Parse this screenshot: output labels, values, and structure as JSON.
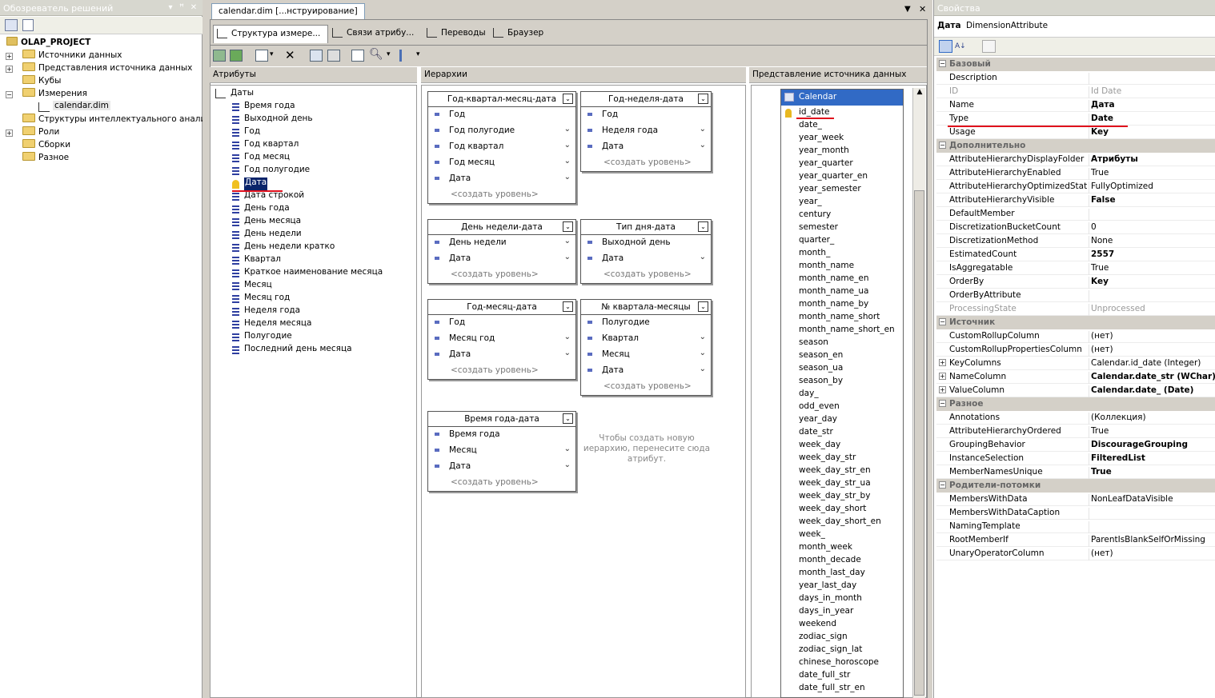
{
  "solution_explorer": {
    "title": "Обозреватель решений",
    "project": "OLAP_PROJECT",
    "items": [
      {
        "label": "Источники данных"
      },
      {
        "label": "Представления источника данных"
      },
      {
        "label": "Кубы"
      },
      {
        "label": "Измерения"
      },
      {
        "label": "calendar.dim"
      },
      {
        "label": "Структуры интеллектуального анализа"
      },
      {
        "label": "Роли"
      },
      {
        "label": "Сборки"
      },
      {
        "label": "Разное"
      }
    ]
  },
  "document": {
    "tab": "calendar.dim [...нструирование]",
    "subtabs": [
      "Структура измере...",
      "Связи атрибу...",
      "Переводы",
      "Браузер"
    ]
  },
  "attributes": {
    "header": "Атрибуты",
    "root": "Даты",
    "items": [
      "Время года",
      "Выходной день",
      "Год",
      "Год квартал",
      "Год месяц",
      "Год полугодие",
      "Дата",
      "Дата строкой",
      "День года",
      "День месяца",
      "День недели",
      "День недели кратко",
      "Квартал",
      "Краткое наименование месяца",
      "Месяц",
      "Месяц год",
      "Неделя года",
      "Неделя месяца",
      "Полугодие",
      "Последний день месяца"
    ]
  },
  "hierarchies": {
    "header": "Иерархии",
    "new_level": "<создать уровень>",
    "hint": "Чтобы создать новую иерархию, перенесите сюда атрибут.",
    "boxes": [
      {
        "title": "Год-квартал-месяц-дата",
        "levels": [
          "Год",
          "Год полугодие",
          "Год квартал",
          "Год месяц",
          "Дата"
        ]
      },
      {
        "title": "Год-неделя-дата",
        "levels": [
          "Год",
          "Неделя года",
          "Дата"
        ]
      },
      {
        "title": "День недели-дата",
        "levels": [
          "День недели",
          "Дата"
        ]
      },
      {
        "title": "Тип дня-дата",
        "levels": [
          "Выходной день",
          "Дата"
        ]
      },
      {
        "title": "Год-месяц-дата",
        "levels": [
          "Год",
          "Месяц год",
          "Дата"
        ]
      },
      {
        "title": "№ квартала-месяцы",
        "levels": [
          "Полугодие",
          "Квартал",
          "Месяц",
          "Дата"
        ]
      },
      {
        "title": "Время года-дата",
        "levels": [
          "Время года",
          "Месяц",
          "Дата"
        ]
      }
    ]
  },
  "dsv": {
    "header": "Представление источника данных",
    "table": "Calendar",
    "columns": [
      "id_date",
      "date_",
      "year_week",
      "year_month",
      "year_quarter",
      "year_quarter_en",
      "year_semester",
      "year_",
      "century",
      "semester",
      "quarter_",
      "month_",
      "month_name",
      "month_name_en",
      "month_name_ua",
      "month_name_by",
      "month_name_short",
      "month_name_short_en",
      "season",
      "season_en",
      "season_ua",
      "season_by",
      "day_",
      "odd_even",
      "year_day",
      "date_str",
      "week_day",
      "week_day_str",
      "week_day_str_en",
      "week_day_str_ua",
      "week_day_str_by",
      "week_day_short",
      "week_day_short_en",
      "week_",
      "month_week",
      "month_decade",
      "month_last_day",
      "year_last_day",
      "days_in_month",
      "days_in_year",
      "weekend",
      "zodiac_sign",
      "zodiac_sign_lat",
      "chinese_horoscope",
      "date_full_str",
      "date_full_str_en"
    ]
  },
  "properties": {
    "title": "Свойства",
    "object_name": "Дата",
    "object_type": "DimensionAttribute",
    "categories": [
      {
        "name": "Базовый",
        "rows": [
          {
            "n": "Description",
            "v": ""
          },
          {
            "n": "ID",
            "v": "Id Date"
          },
          {
            "n": "Name",
            "v": "Дата"
          },
          {
            "n": "Type",
            "v": "Date"
          },
          {
            "n": "Usage",
            "v": "Key"
          }
        ]
      },
      {
        "name": "Дополнительно",
        "rows": [
          {
            "n": "AttributeHierarchyDisplayFolder",
            "v": "Атрибуты"
          },
          {
            "n": "AttributeHierarchyEnabled",
            "v": "True"
          },
          {
            "n": "AttributeHierarchyOptimizedState",
            "v": "FullyOptimized"
          },
          {
            "n": "AttributeHierarchyVisible",
            "v": "False"
          },
          {
            "n": "DefaultMember",
            "v": ""
          },
          {
            "n": "DiscretizationBucketCount",
            "v": "0"
          },
          {
            "n": "DiscretizationMethod",
            "v": "None"
          },
          {
            "n": "EstimatedCount",
            "v": "2557"
          },
          {
            "n": "IsAggregatable",
            "v": "True"
          },
          {
            "n": "OrderBy",
            "v": "Key"
          },
          {
            "n": "OrderByAttribute",
            "v": ""
          },
          {
            "n": "ProcessingState",
            "v": "Unprocessed"
          }
        ]
      },
      {
        "name": "Источник",
        "rows": [
          {
            "n": "CustomRollupColumn",
            "v": "(нет)"
          },
          {
            "n": "CustomRollupPropertiesColumn",
            "v": "(нет)"
          },
          {
            "n": "KeyColumns",
            "v": "Calendar.id_date (Integer)"
          },
          {
            "n": "NameColumn",
            "v": "Calendar.date_str (WChar)"
          },
          {
            "n": "ValueColumn",
            "v": "Calendar.date_ (Date)"
          }
        ]
      },
      {
        "name": "Разное",
        "rows": [
          {
            "n": "Annotations",
            "v": "(Коллекция)"
          },
          {
            "n": "AttributeHierarchyOrdered",
            "v": "True"
          },
          {
            "n": "GroupingBehavior",
            "v": "DiscourageGrouping"
          },
          {
            "n": "InstanceSelection",
            "v": "FilteredList"
          },
          {
            "n": "MemberNamesUnique",
            "v": "True"
          }
        ]
      },
      {
        "name": "Родители-потомки",
        "rows": [
          {
            "n": "MembersWithData",
            "v": "NonLeafDataVisible"
          },
          {
            "n": "MembersWithDataCaption",
            "v": ""
          },
          {
            "n": "NamingTemplate",
            "v": ""
          },
          {
            "n": "RootMemberIf",
            "v": "ParentIsBlankSelfOrMissing"
          },
          {
            "n": "UnaryOperatorColumn",
            "v": "(нет)"
          }
        ]
      }
    ]
  }
}
